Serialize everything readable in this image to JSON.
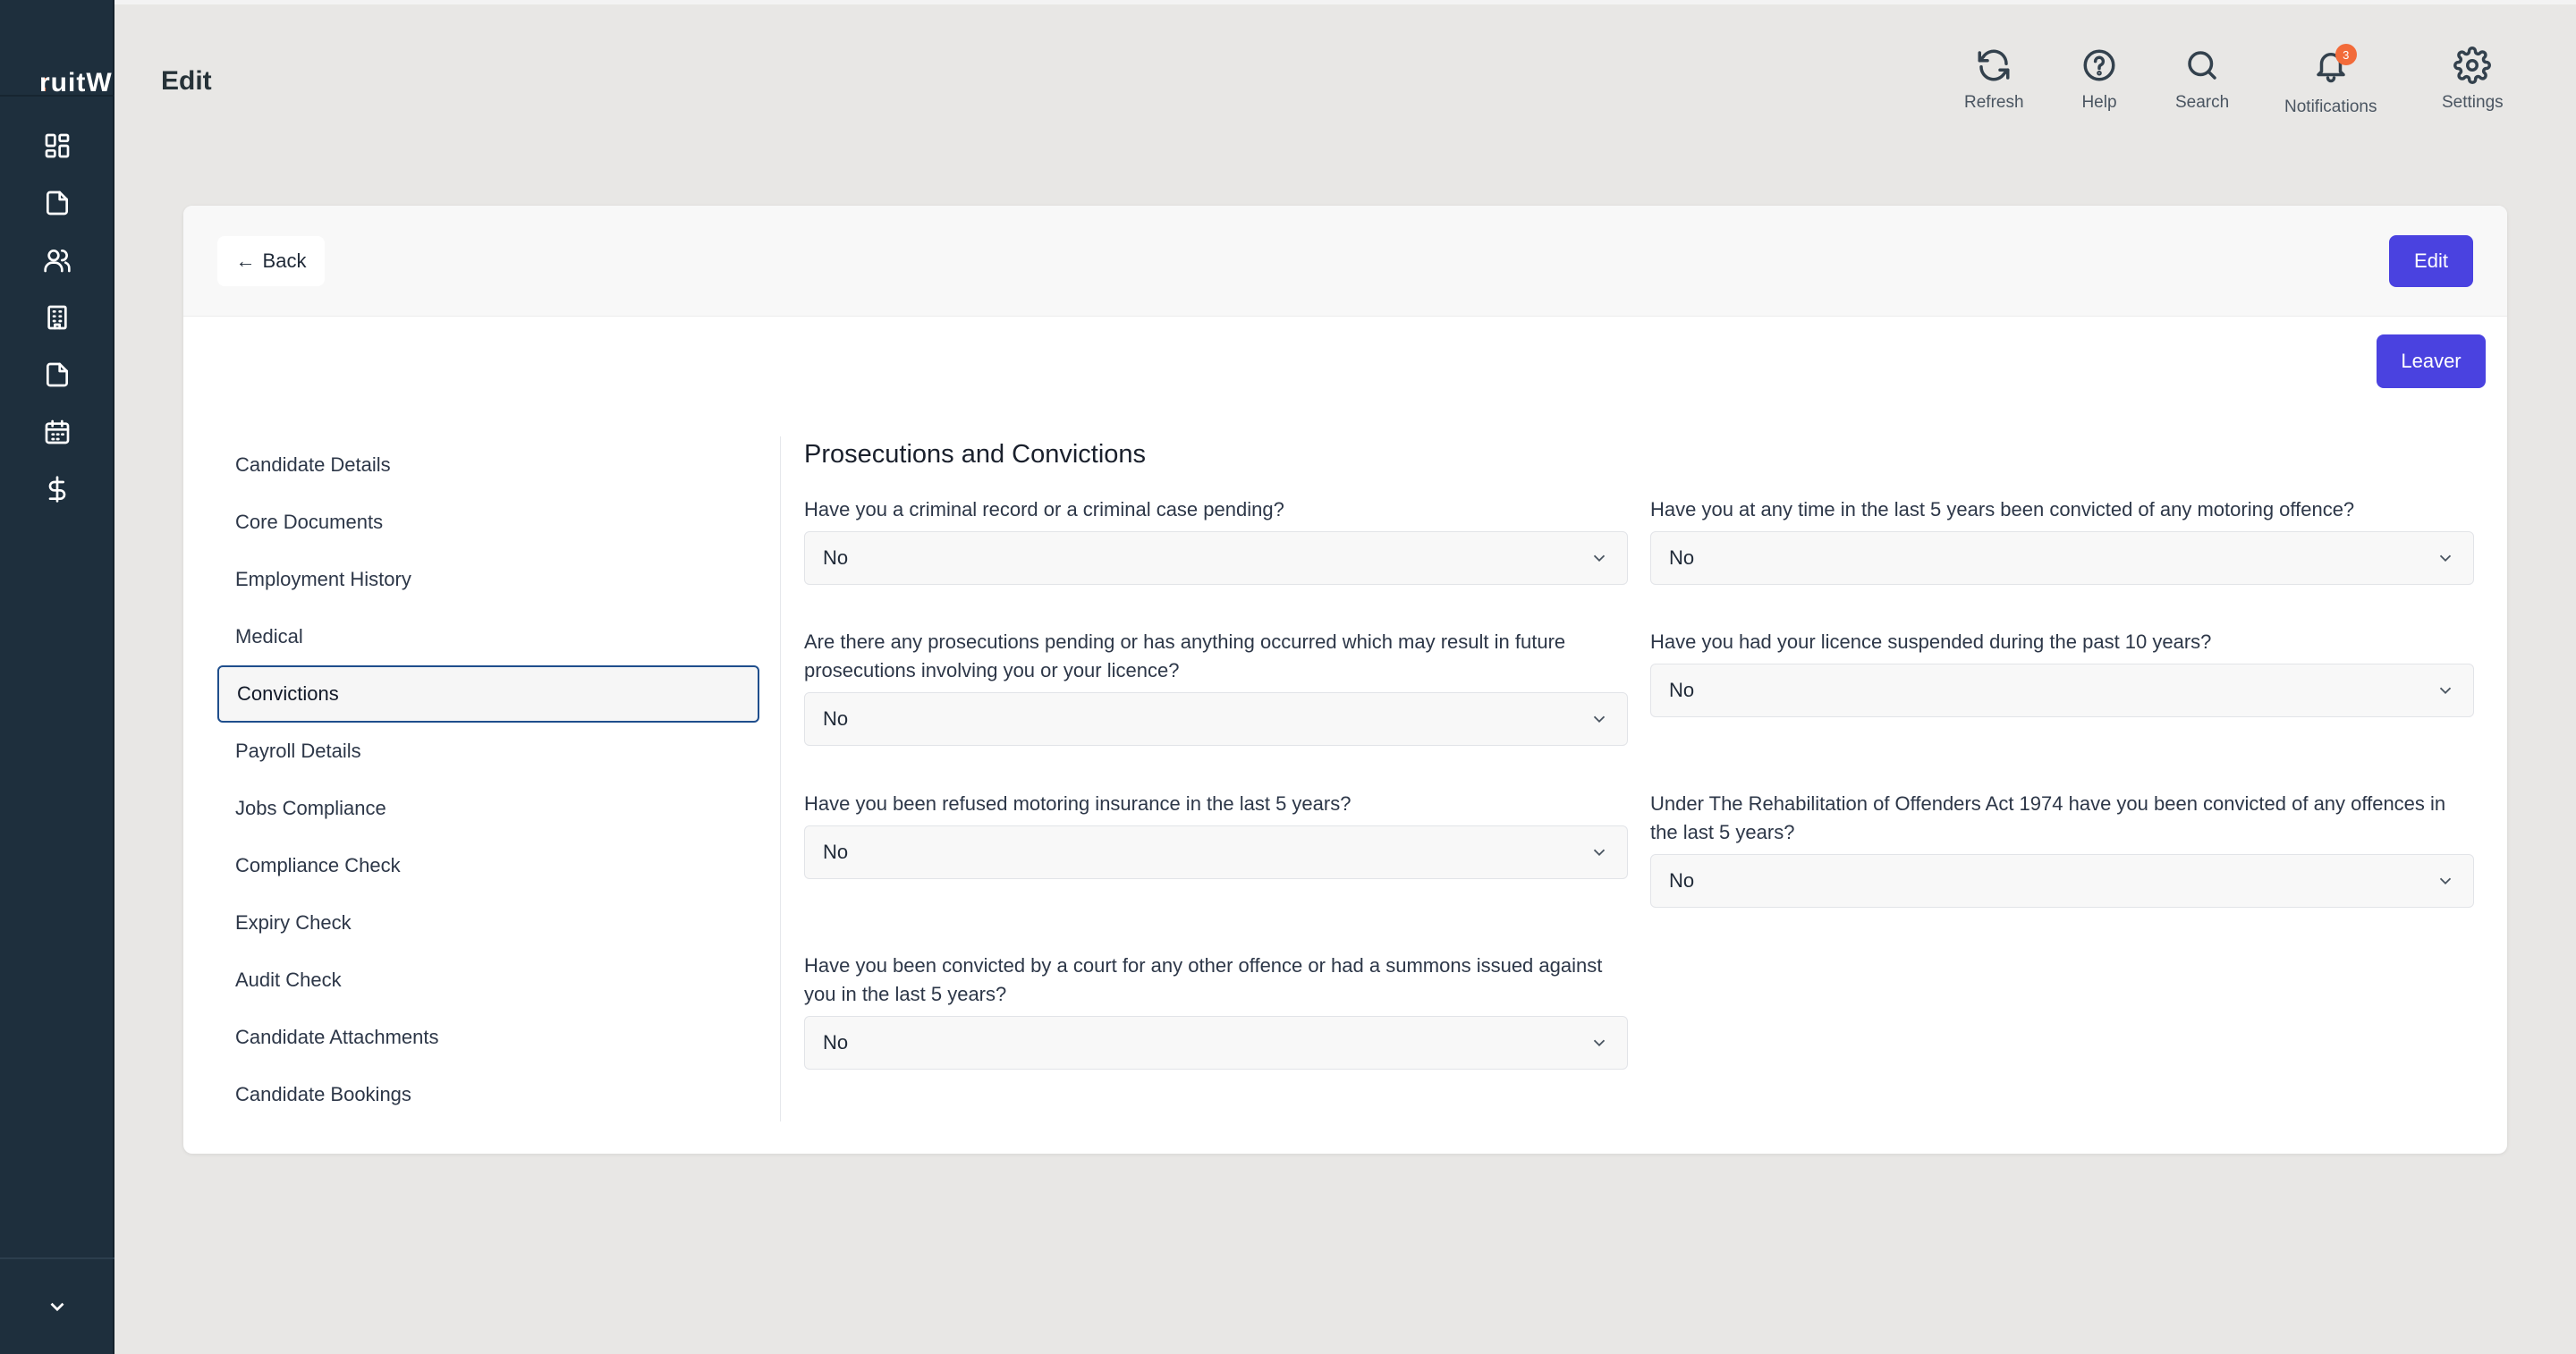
{
  "app": {
    "logo_text": "ruitW"
  },
  "header": {
    "title": "Edit",
    "actions": [
      {
        "label": "Refresh",
        "icon": "refresh-icon"
      },
      {
        "label": "Help",
        "icon": "help-icon"
      },
      {
        "label": "Search",
        "icon": "search-icon"
      },
      {
        "label": "Notifications",
        "icon": "bell-icon",
        "badge": "3"
      },
      {
        "label": "Settings",
        "icon": "gear-icon"
      }
    ]
  },
  "toolbar": {
    "back_label": "Back",
    "edit_label": "Edit",
    "leaver_label": "Leaver"
  },
  "side_nav": {
    "items": [
      "Candidate Details",
      "Core Documents",
      "Employment History",
      "Medical",
      "Convictions",
      "Payroll Details",
      "Jobs Compliance",
      "Compliance Check",
      "Expiry Check",
      "Audit Check",
      "Candidate Attachments",
      "Candidate Bookings"
    ],
    "active": "Convictions"
  },
  "form": {
    "title": "Prosecutions and Convictions",
    "questions": [
      {
        "label": "Have you a criminal record or a criminal case pending?",
        "value": "No"
      },
      {
        "label": "Have you at any time in the last 5 years been convicted of any motoring offence?",
        "value": "No"
      },
      {
        "label": "Are there any prosecutions pending or has anything occurred which may result in future prosecutions involving you or your licence?",
        "value": "No"
      },
      {
        "label": "Have you had your licence suspended during the past 10 years?",
        "value": "No"
      },
      {
        "label": "Have you been refused motoring insurance in the last 5 years?",
        "value": "No"
      },
      {
        "label": "Under The Rehabilitation of Offenders Act 1974 have you been convicted of any offences in the last 5 years?",
        "value": "No"
      },
      {
        "label": "Have you been convicted by a court for any other offence or had a summons issued against you in the last 5 years?",
        "value": "No"
      }
    ]
  },
  "colors": {
    "sidebar": "#1e2f3d",
    "accent": "#4a42e0",
    "brand_orange": "#f26b3a"
  }
}
